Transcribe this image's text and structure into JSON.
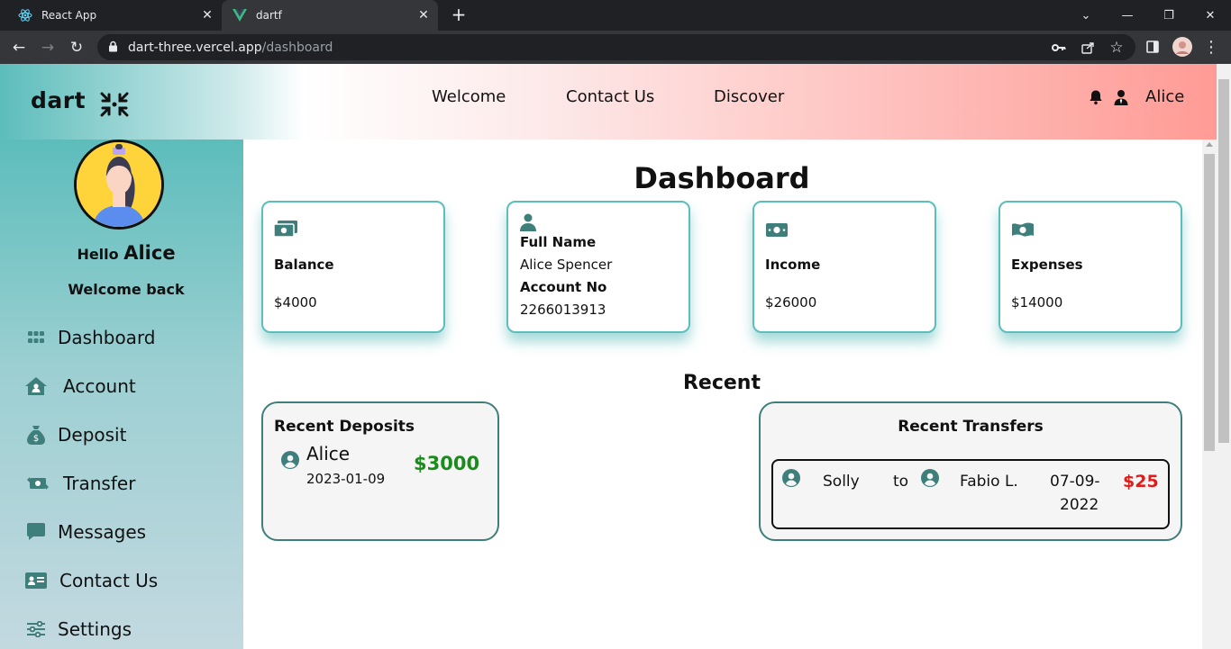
{
  "browser": {
    "tabs": [
      {
        "title": "React App",
        "icon": "react-icon"
      },
      {
        "title": "dartf",
        "icon": "vue-icon"
      }
    ],
    "url_host": "dart-three.vercel.app",
    "url_path": "/dashboard"
  },
  "header": {
    "logo": "dart",
    "nav": [
      "Welcome",
      "Contact Us",
      "Discover"
    ],
    "user": "Alice"
  },
  "sidebar": {
    "hello_prefix": "Hello",
    "user_name": "Alice",
    "welcome": "Welcome back",
    "items": [
      {
        "label": "Dashboard",
        "icon": "grid-icon"
      },
      {
        "label": "Account",
        "icon": "house-user-icon"
      },
      {
        "label": "Deposit",
        "icon": "money-bag-icon"
      },
      {
        "label": "Transfer",
        "icon": "money-transfer-icon"
      },
      {
        "label": "Messages",
        "icon": "message-icon"
      },
      {
        "label": "Contact Us",
        "icon": "address-card-icon"
      },
      {
        "label": "Settings",
        "icon": "sliders-icon"
      }
    ]
  },
  "dashboard": {
    "title": "Dashboard",
    "cards": {
      "balance": {
        "label": "Balance",
        "value": "$4000"
      },
      "profile": {
        "full_name_label": "Full Name",
        "full_name": "Alice Spencer",
        "account_label": "Account No",
        "account_no": "2266013913"
      },
      "income": {
        "label": "Income",
        "value": "$26000"
      },
      "expenses": {
        "label": "Expenses",
        "value": "$14000"
      }
    },
    "recent_title": "Recent",
    "recent_deposits": {
      "title": "Recent Deposits",
      "name": "Alice",
      "date": "2023-01-09",
      "amount": "$3000"
    },
    "recent_transfers": {
      "title": "Recent Transfers",
      "from": "Solly",
      "to_word": "to",
      "to": "Fabio L.",
      "date_part1": "07-09-",
      "date_part2": "2022",
      "amount": "$25"
    }
  },
  "colors": {
    "accent": "#5cbdbb",
    "deposit_amount": "#1b8b1b",
    "transfer_amount": "#e61919",
    "icon_teal": "#3e7f7c"
  }
}
